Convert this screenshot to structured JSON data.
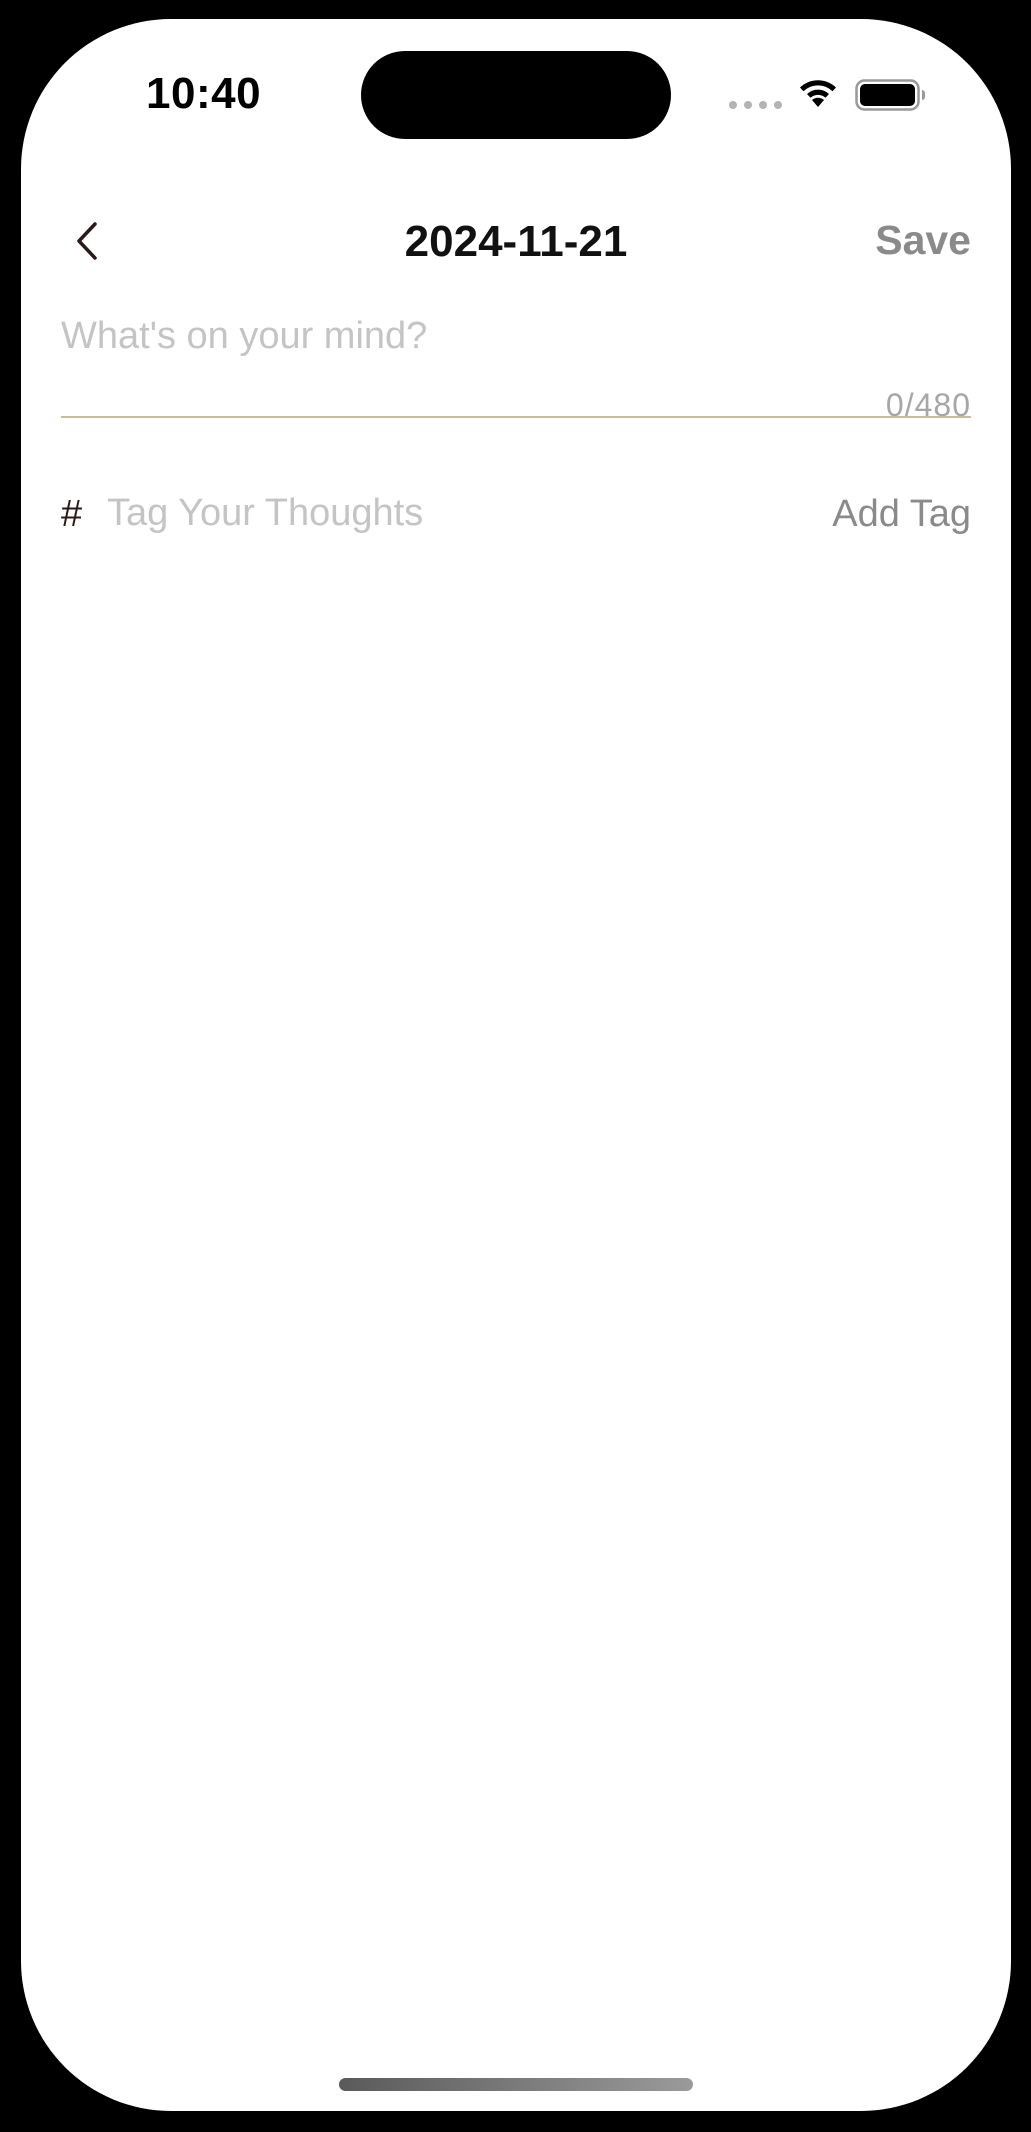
{
  "status_bar": {
    "time": "10:40",
    "icons": [
      "signal-dots-icon",
      "wifi-icon",
      "battery-icon"
    ]
  },
  "nav": {
    "back_icon": "chevron-left-icon",
    "title": "2024-11-21",
    "save_label": "Save"
  },
  "editor": {
    "placeholder": "What's on your mind?",
    "value": "",
    "char_count": "0/480"
  },
  "tags": {
    "hash_symbol": "#",
    "placeholder": "Tag Your Thoughts",
    "add_label": "Add Tag"
  },
  "colors": {
    "divider": "#c9bd98",
    "placeholder": "#c4c4c4",
    "muted_text": "#8a8a8a"
  }
}
